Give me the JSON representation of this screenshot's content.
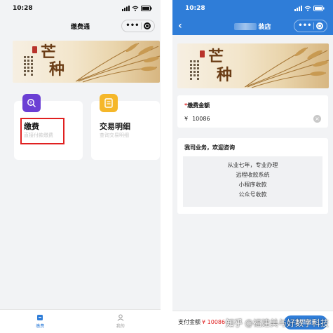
{
  "left": {
    "status": {
      "time": "10:28"
    },
    "nav": {
      "title": "缴费通",
      "menu": "•••"
    },
    "banner": {
      "calligraphy": [
        "芒",
        "种"
      ]
    },
    "cards": [
      {
        "title": "缴费",
        "subtitle": "直接付款缴费",
        "icon": "payment-search-icon",
        "color": "#6b3fd4"
      },
      {
        "title": "交易明细",
        "subtitle": "查询交易明细",
        "icon": "document-icon",
        "color": "#f5b72a"
      }
    ],
    "tabs": [
      {
        "label": "缴费",
        "icon": "home-icon",
        "active": true
      },
      {
        "label": "我的",
        "icon": "person-icon",
        "active": false
      }
    ]
  },
  "right": {
    "status": {
      "time": "10:28"
    },
    "nav": {
      "title_suffix": "装店",
      "menu": "•••"
    },
    "form": {
      "label": "缴费金额",
      "required_mark": "*",
      "currency": "¥",
      "amount": "10086"
    },
    "info": {
      "heading": "我司业务，欢迎咨询",
      "lines": [
        "从业七年，专业办理",
        "远程收款系统",
        "小程序收款",
        "公众号收款"
      ]
    },
    "paybar": {
      "label": "支付金额",
      "amount": "¥ 10086",
      "button": "立即缴费"
    }
  },
  "watermark": {
    "logo": "知乎",
    "text": "@福建美与好数字科技"
  },
  "colors": {
    "accent_blue": "#2f7dd8",
    "highlight_red": "#e02020",
    "card_purple": "#6b3fd4",
    "card_yellow": "#f5b72a"
  }
}
